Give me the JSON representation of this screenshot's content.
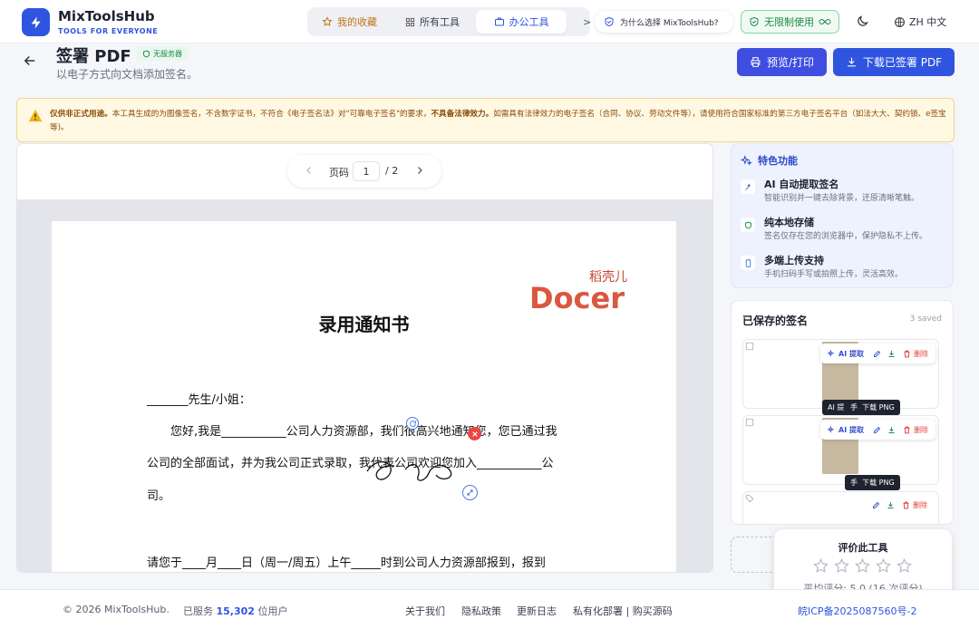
{
  "header": {
    "brand": "MixToolsHub",
    "brand_sub": "TOOLS FOR EVERYONE",
    "nav": {
      "favorites": "我的收藏",
      "all_tools": "所有工具",
      "office_tools": "办公工具",
      "more": ">_"
    },
    "why": "为什么选择 MixToolsHub?",
    "unlimited": "无限制使用",
    "lang": "ZH 中文"
  },
  "page": {
    "title": "签署 PDF",
    "badge": "无服务器",
    "subtitle": "以电子方式向文档添加签名。",
    "btn_print": "预览/打印",
    "btn_download": "下载已签署 PDF"
  },
  "warning": {
    "lead": "仅供非正式用途。",
    "body1": "本工具生成的为图像签名，不含数字证书，不符合《电子签名法》对\"可靠电子签名\"的要求，",
    "bold2": "不具备法律效力。",
    "body2": "如需具有法律效力的电子签名（合同、协议、劳动文件等），请使用符合国家标准的第三方电子签名平台（如法大大、契约锁、e签宝等)。"
  },
  "viewer": {
    "page_label": "页码",
    "page_current": "1",
    "page_total": "/ 2",
    "doc": {
      "logo_cn": "稻壳儿",
      "logo_en": "Docer",
      "title": "录用通知书",
      "line1": "_______先生/小姐：",
      "line2": "您好,我是___________公司人力资源部，我们很高兴地通知您，您已通过我",
      "line3": "公司的全部面试，并为我公司正式录取，我代表公司欢迎您加入___________公",
      "line4": "司。",
      "line5": "请您于____月____日（周一/周五）上午_____时到公司人力资源部报到，报到"
    }
  },
  "features": {
    "title": "特色功能",
    "items": [
      {
        "title": "AI 自动提取签名",
        "desc": "智能识别并一键去除背景，还原清晰笔触。"
      },
      {
        "title": "纯本地存储",
        "desc": "签名仅存在您的浏览器中，保护隐私不上传。"
      },
      {
        "title": "多端上传支持",
        "desc": "手机扫码手写或拍照上传，灵活高效。"
      }
    ]
  },
  "saved": {
    "title": "已保存的签名",
    "count": "3 saved",
    "ai_label": "AI 提取",
    "delete_label": "删除",
    "tip_download": "下载 PNG",
    "tip_hand": "手",
    "tip_ai_short": "AI 提"
  },
  "rating": {
    "title": "评价此工具",
    "avg": "平均评分: 5.0 (16 次评分)"
  },
  "footer": {
    "copyright": "© 2026 MixToolsHub.",
    "served_prefix": "已服务",
    "served_count": "15,302",
    "served_suffix": "位用户",
    "links": [
      "关于我们",
      "隐私政策",
      "更新日志",
      "私有化部署 | 购买源码"
    ],
    "icp": "皖ICP备2025087560号-2"
  }
}
